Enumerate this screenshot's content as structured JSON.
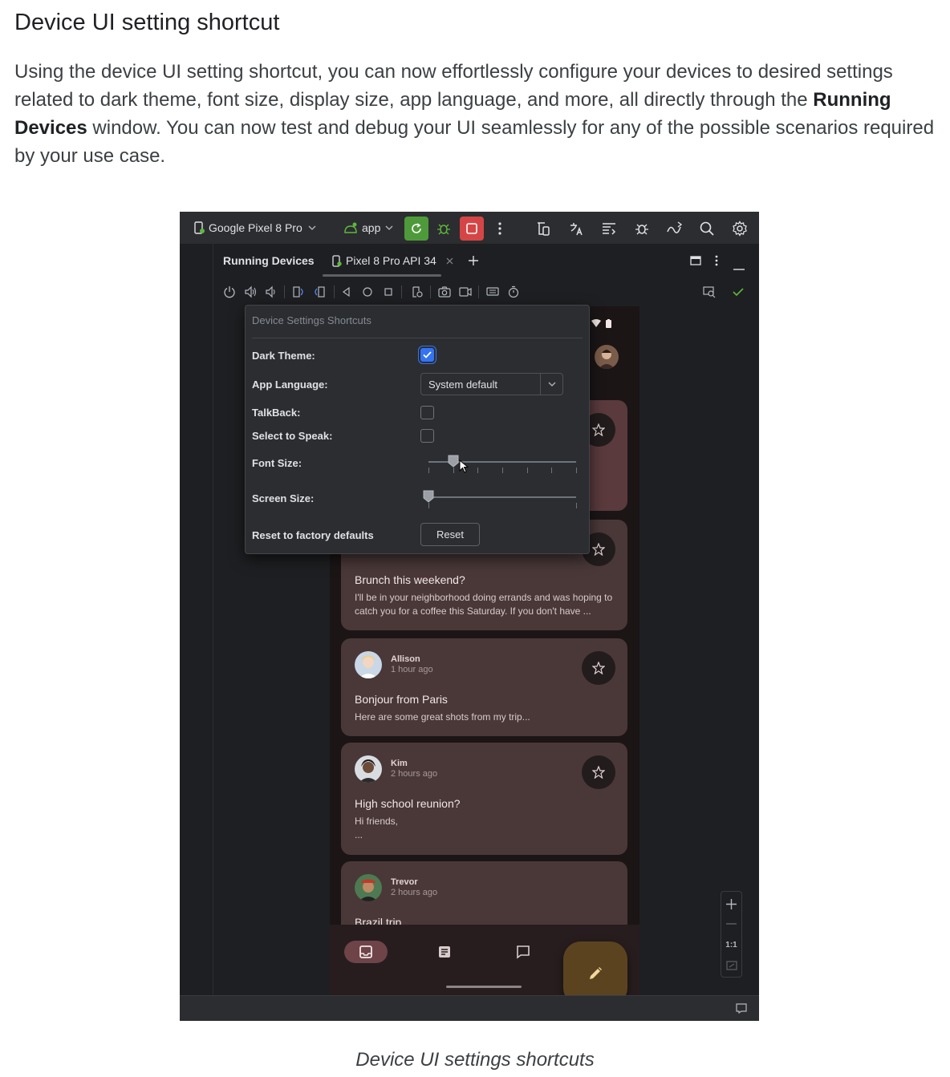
{
  "article": {
    "heading": "Device UI setting shortcut",
    "para_1": "Using the device UI setting shortcut, you can now effortlessly configure your devices to desired settings related to dark theme, font size, display size, app language, and more, all directly through the",
    "para_bold": "Running Devices",
    "para_2": " window. You can now test and debug your UI seamlessly for any of the possible scenarios required by your use case.",
    "caption": "Device UI settings shortcuts"
  },
  "ide": {
    "device_selector": "Google Pixel 8 Pro",
    "run_config": "app",
    "colors": {
      "rerun": "#4e9a3a",
      "stop": "#d64545",
      "debug": "#5fb83b",
      "check": "#5fb83b"
    },
    "tool_window": {
      "title": "Running Devices",
      "tab_label": "Pixel 8 Pro API 34"
    },
    "popup": {
      "title": "Device Settings Shortcuts",
      "dark_theme_label": "Dark Theme:",
      "dark_theme_checked": true,
      "app_language_label": "App Language:",
      "app_language_value": "System default",
      "talkback_label": "TalkBack:",
      "talkback_checked": false,
      "select_to_speak_label": "Select to Speak:",
      "select_to_speak_checked": false,
      "font_size_label": "Font Size:",
      "font_size_level": 1,
      "font_size_steps": 7,
      "screen_size_label": "Screen Size:",
      "screen_size_level": 0,
      "screen_size_steps": 2,
      "reset_label": "Reset to factory defaults",
      "reset_button": "Reset"
    },
    "zoom_ratio": "1:1"
  },
  "emails": [
    {
      "sender": "",
      "time": "",
      "subject": "Brunch this weekend?",
      "body": "I'll be in your neighborhood doing errands and was hoping to catch you for a coffee this Saturday. If you don't have ..."
    },
    {
      "sender": "Allison",
      "time": "1 hour ago",
      "subject": "Bonjour from Paris",
      "body": "Here are some great shots from my trip..."
    },
    {
      "sender": "Kim",
      "time": "2 hours ago",
      "subject": "High school reunion?",
      "body": "Hi friends,\n..."
    },
    {
      "sender": "Trevor",
      "time": "2 hours ago",
      "subject": "Brazil trip",
      "body": ""
    }
  ]
}
